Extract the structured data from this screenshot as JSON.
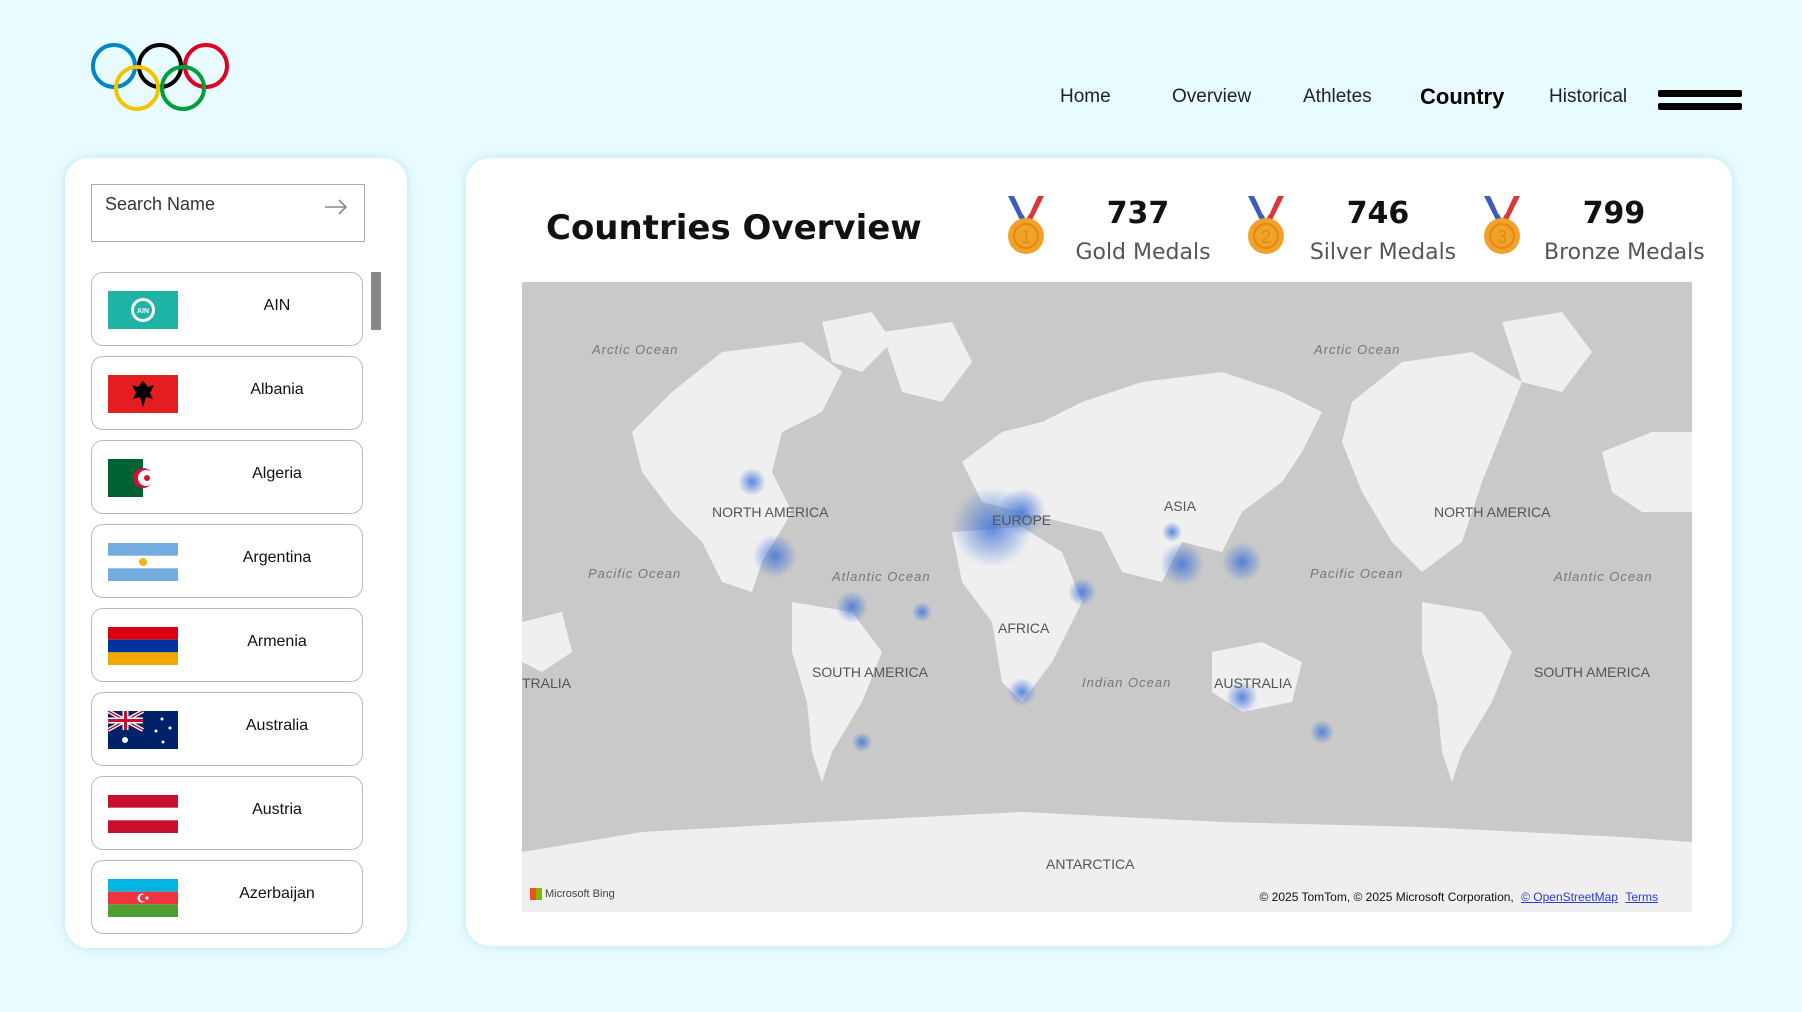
{
  "nav": {
    "items": [
      {
        "label": "Home"
      },
      {
        "label": "Overview"
      },
      {
        "label": "Athletes"
      },
      {
        "label": "Country"
      },
      {
        "label": "Historical"
      }
    ]
  },
  "sidebar": {
    "search": {
      "placeholder": "Search Name"
    },
    "countries": [
      {
        "name": "AIN",
        "flag": "ain-flag-icon"
      },
      {
        "name": "Albania",
        "flag": "albania-flag-icon"
      },
      {
        "name": "Algeria",
        "flag": "algeria-flag-icon"
      },
      {
        "name": "Argentina",
        "flag": "argentina-flag-icon"
      },
      {
        "name": "Armenia",
        "flag": "armenia-flag-icon"
      },
      {
        "name": "Australia",
        "flag": "australia-flag-icon"
      },
      {
        "name": "Austria",
        "flag": "austria-flag-icon"
      },
      {
        "name": "Azerbaijan",
        "flag": "azerbaijan-flag-icon"
      }
    ]
  },
  "main": {
    "title": "Countries Overview",
    "medals": [
      {
        "value": "737",
        "label": "Gold Medals",
        "rank": "1"
      },
      {
        "value": "746",
        "label": "Silver Medals",
        "rank": "2"
      },
      {
        "value": "799",
        "label": "Bronze Medals",
        "rank": "3"
      }
    ],
    "map": {
      "labels": {
        "arctic_left": "Arctic Ocean",
        "arctic_right": "Arctic Ocean",
        "na_left": "NORTH AMERICA",
        "na_right": "NORTH AMERICA",
        "europe": "EUROPE",
        "asia": "ASIA",
        "pacific_left": "Pacific Ocean",
        "pacific_right": "Pacific Ocean",
        "atlantic_left": "Atlantic Ocean",
        "atlantic_right": "Atlantic Ocean",
        "africa": "AFRICA",
        "sa_left": "SOUTH AMERICA",
        "sa_right": "SOUTH AMERICA",
        "tralia": "TRALIA",
        "indian": "Indian Ocean",
        "australia": "AUSTRALIA",
        "antarctica": "ANTARCTICA"
      },
      "bing": "Microsoft Bing",
      "attribution": "© 2025 TomTom, © 2025 Microsoft Corporation,",
      "osm": "© OpenStreetMap",
      "terms": "Terms"
    }
  },
  "colors": {
    "background": "#e8fbff",
    "gold": "#f2a12a",
    "ribbon_red": "#d9383a",
    "ribbon_blue": "#3b5bbf",
    "heat": "#3f74d8"
  }
}
